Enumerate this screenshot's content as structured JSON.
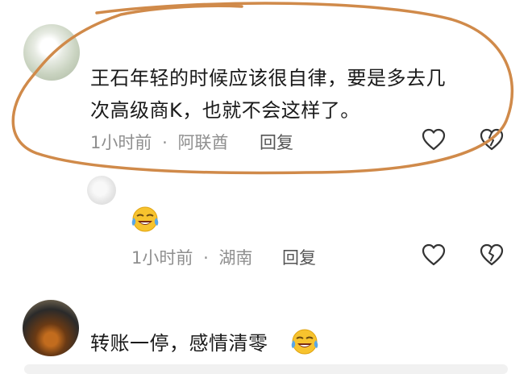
{
  "comments": [
    {
      "text_lines": [
        "王石年轻的时候应该很自律，要是多去几",
        "次高级商K，也就不会这样了。"
      ],
      "time": "1小时前",
      "separator": "·",
      "location": "阿联酋",
      "reply_label": "回复"
    },
    {
      "emoji": "laughing-crying-emoji",
      "time": "1小时前",
      "separator": "·",
      "location": "湖南",
      "reply_label": "回复"
    },
    {
      "text": "转账一停，感情清零",
      "emoji": "laughing-crying-emoji"
    }
  ],
  "icons": {
    "like": "heart-outline-icon",
    "dislike": "broken-heart-icon"
  },
  "colors": {
    "annotation": "#d08a4a",
    "meta_text": "#8f8f8f",
    "reply_text": "#555555",
    "icon_stroke": "#333333"
  }
}
